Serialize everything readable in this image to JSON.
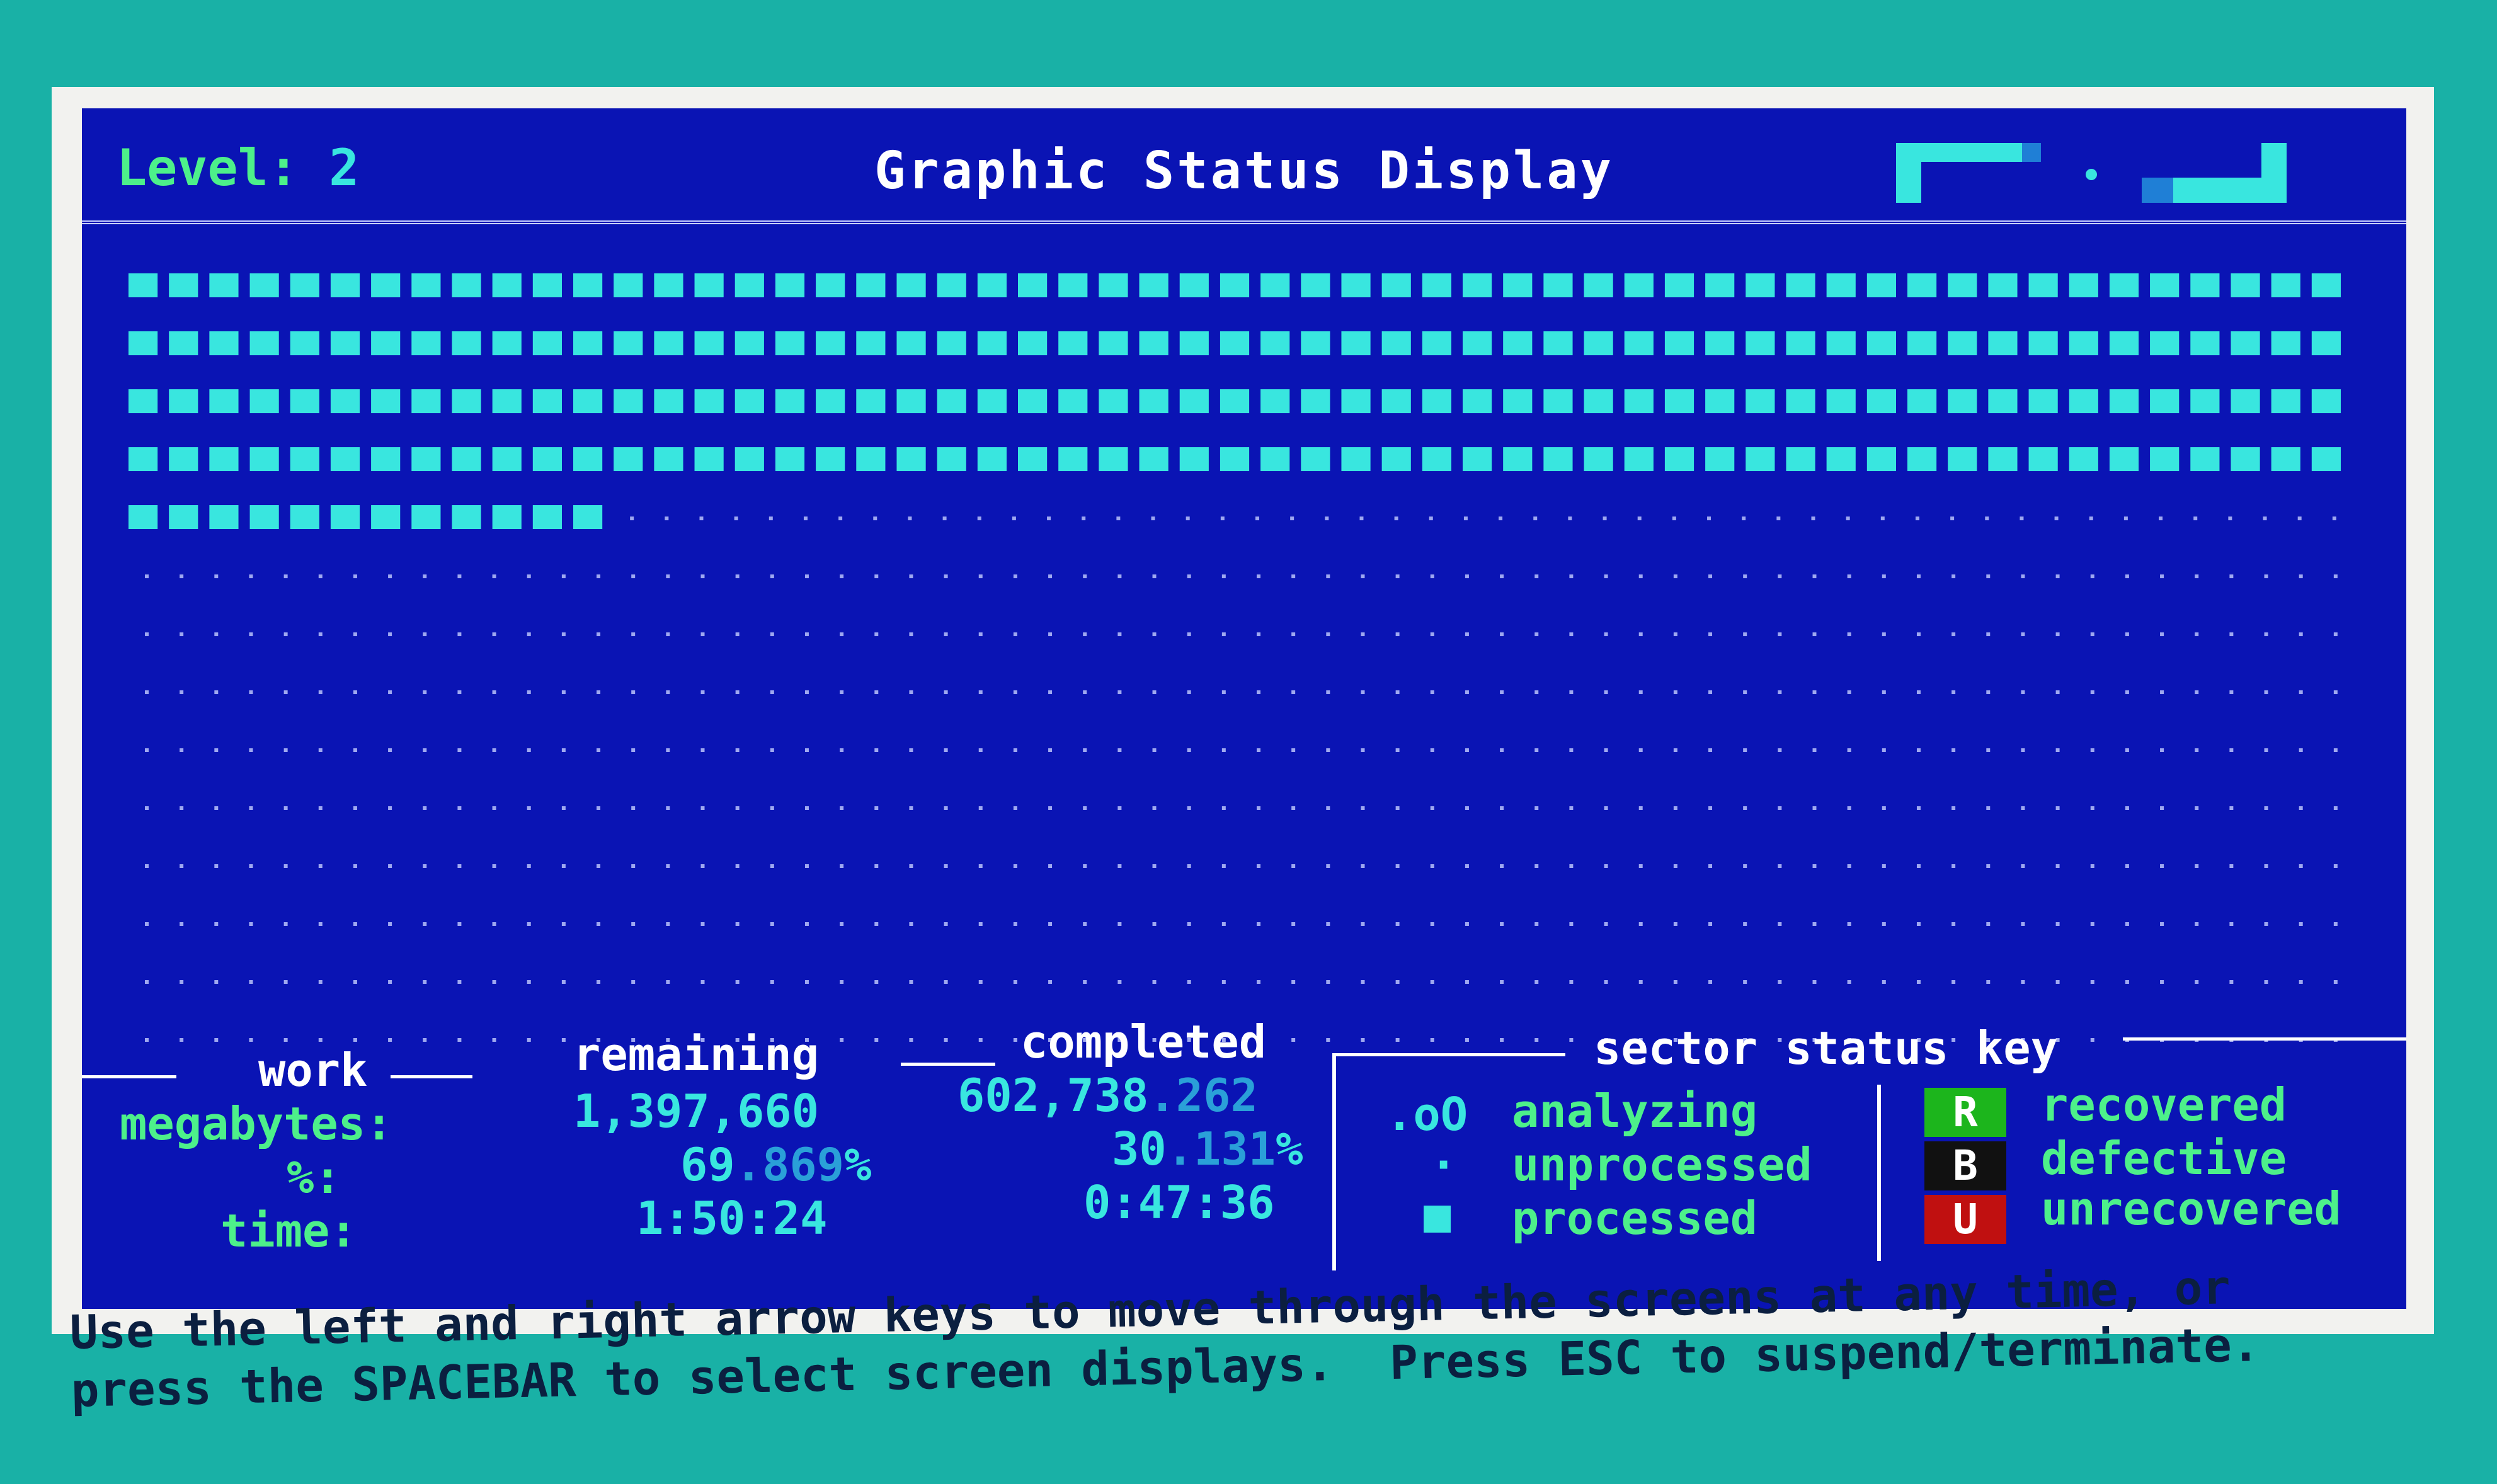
{
  "header": {
    "level_label": "Level:",
    "level_value": "2",
    "title": "Graphic Status Display"
  },
  "progress_map": {
    "total_rows": 14,
    "processed_full_rows": 4,
    "processed_partial_row_fraction": 0.21,
    "processed_fraction": 0.30131
  },
  "stats": {
    "work_header": "work",
    "remaining_header": "remaining",
    "completed_header": "completed",
    "row_labels": {
      "megabytes": "megabytes:",
      "percent": "%:",
      "time": "time:"
    },
    "remaining": {
      "megabytes": "1,397,660",
      "percent_main": "69",
      "percent_frac": ".869",
      "percent_sign": "%",
      "time": "1:50:24"
    },
    "completed": {
      "megabytes_main": "602,738",
      "megabytes_frac": ".262",
      "percent_main": "30",
      "percent_frac": ".131",
      "percent_sign": "%",
      "time": "0:47:36"
    }
  },
  "key": {
    "title": "sector status key",
    "analyzing_symbol": ".oO",
    "analyzing_label": "analyzing",
    "unprocessed_symbol": "·",
    "unprocessed_label": "unprocessed",
    "processed_symbol": "■",
    "processed_label": "processed",
    "recovered_badge": "R",
    "recovered_label": "recovered",
    "defective_badge": "B",
    "defective_label": "defective",
    "unrecovered_badge": "U",
    "unrecovered_label": "unrecovered"
  },
  "colors": {
    "screen_bg": "#0a14b4",
    "processed": "#39e6df",
    "label_green": "#4df08a",
    "recovered": "#1cb51c",
    "defective": "#111111",
    "unrecovered": "#c01010"
  },
  "footer": {
    "line1": "Use the left and right arrow keys to move through the screens at any time, or",
    "line2": "press the SPACEBAR to select screen displays.  Press ESC to suspend/terminate."
  }
}
